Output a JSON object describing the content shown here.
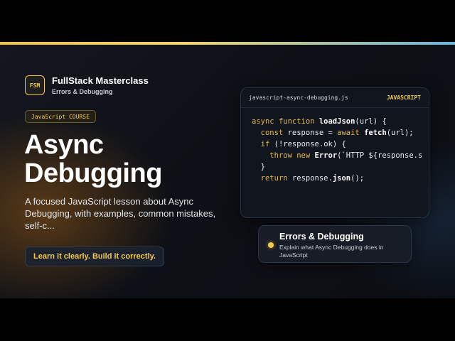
{
  "brand": {
    "logo_text": "FSM",
    "name": "FullStack Masterclass",
    "subtitle": "Errors & Debugging"
  },
  "course_badge": "JavaScript COURSE",
  "hero": {
    "title": "Async Debugging",
    "description": "A focused JavaScript lesson about Async Debugging, with examples, common mistakes, self-c...",
    "tagline": "Learn it clearly. Build it correctly."
  },
  "code": {
    "filename": "javascript-async-debugging.js",
    "language": "JAVASCRIPT",
    "lines": [
      "async function loadJson(url) {",
      "  const response = await fetch(url);",
      "  if (!response.ok) {",
      "    throw new Error(`HTTP ${response.s",
      "  }",
      "  return response.json();"
    ]
  },
  "topic": {
    "title": "Errors & Debugging",
    "description": "Explain what Async Debugging does in JavaScript"
  },
  "colors": {
    "accent": "#f3c94a",
    "background": "#0d1016",
    "bar_end": "#67b5e0"
  }
}
